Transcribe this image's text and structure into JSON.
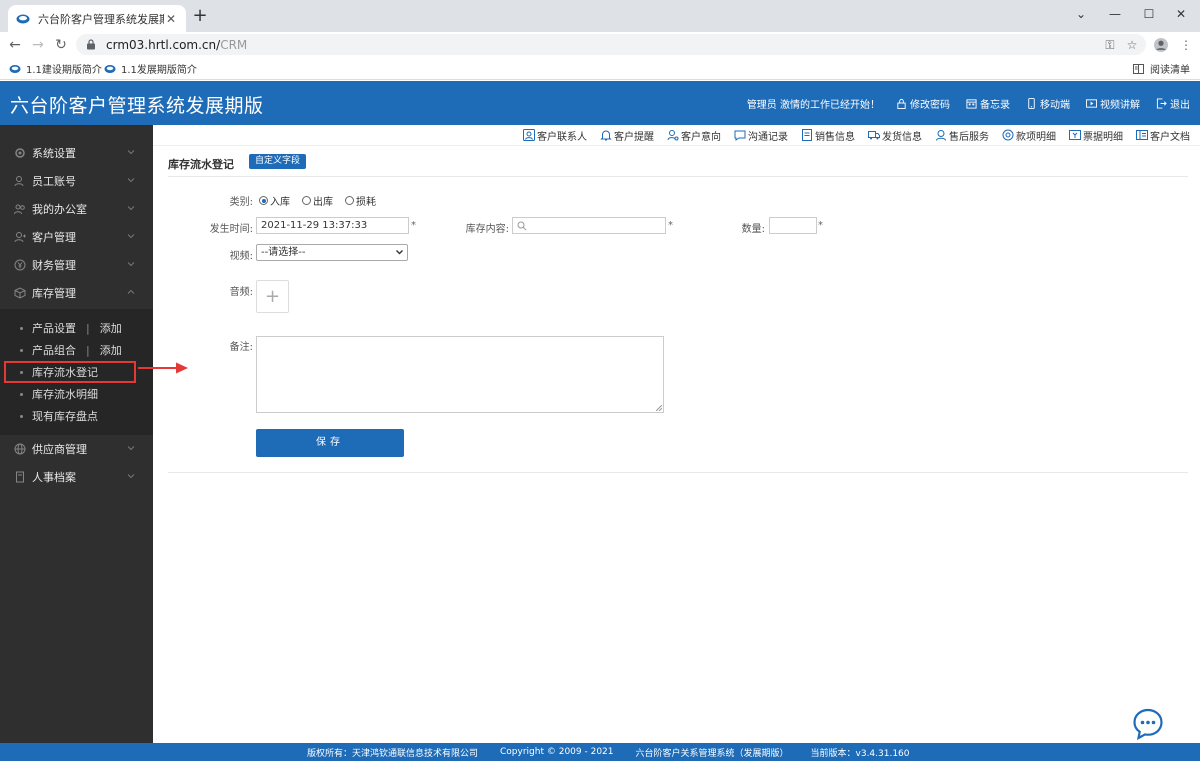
{
  "browser": {
    "tab_title": "六台阶客户管理系统发展期版",
    "url_visible": "crm03.hrtl.com.cn/",
    "url_blurred": "CRM",
    "bookmarks": [
      "1.1建设期版简介",
      "1.1发展期版简介"
    ],
    "reading_list": "阅读清单"
  },
  "header": {
    "app_title": "六台阶客户管理系统发展期版",
    "greeting": "管理员 激情的工作已经开始！",
    "links": [
      "修改密码",
      "备忘录",
      "移动端",
      "视频讲解",
      "退出"
    ]
  },
  "sidebar": {
    "items": [
      {
        "label": "系统设置"
      },
      {
        "label": "员工账号"
      },
      {
        "label": "我的办公室"
      },
      {
        "label": "客户管理"
      },
      {
        "label": "财务管理"
      },
      {
        "label": "库存管理"
      }
    ],
    "sub_items": [
      {
        "label": "产品设置",
        "extra": "添加"
      },
      {
        "label": "产品组合",
        "extra": "添加"
      },
      {
        "label": "库存流水登记"
      },
      {
        "label": "库存流水明细"
      },
      {
        "label": "现有库存盘点"
      }
    ],
    "items_after": [
      {
        "label": "供应商管理"
      },
      {
        "label": "人事档案"
      }
    ]
  },
  "toolbar": {
    "items": [
      "客户联系人",
      "客户提醒",
      "客户意向",
      "沟通记录",
      "销售信息",
      "发货信息",
      "售后服务",
      "款项明细",
      "票据明细",
      "客户文档"
    ]
  },
  "form": {
    "page_title": "库存流水登记",
    "custom_field_button": "自定义字段",
    "category_label": "类别:",
    "category_options": [
      "入库",
      "出库",
      "损耗"
    ],
    "category_selected": "入库",
    "time_label": "发生时间:",
    "time_value": "2021-11-29 13:37:33",
    "content_label": "库存内容:",
    "content_value": "",
    "quantity_label": "数量:",
    "quantity_value": "",
    "required_mark": "*",
    "video_label": "视频:",
    "video_selected": "--请选择--",
    "audio_label": "音频:",
    "upload_plus": "+",
    "remark_label": "备注:",
    "remark_value": "",
    "save_button": "保存"
  },
  "footer": {
    "copyright_owner": "版权所有：天津鸿钦通联信息技术有限公司",
    "copyright_years": "Copyright © 2009 - 2021",
    "system_name": "六台阶客户关系管理系统（发展期版）",
    "version": "当前版本：v3.4.31.160"
  },
  "colors": {
    "primary": "#1e6bb8",
    "sidebar_bg": "#2f2f2f",
    "highlight": "#e53935"
  }
}
